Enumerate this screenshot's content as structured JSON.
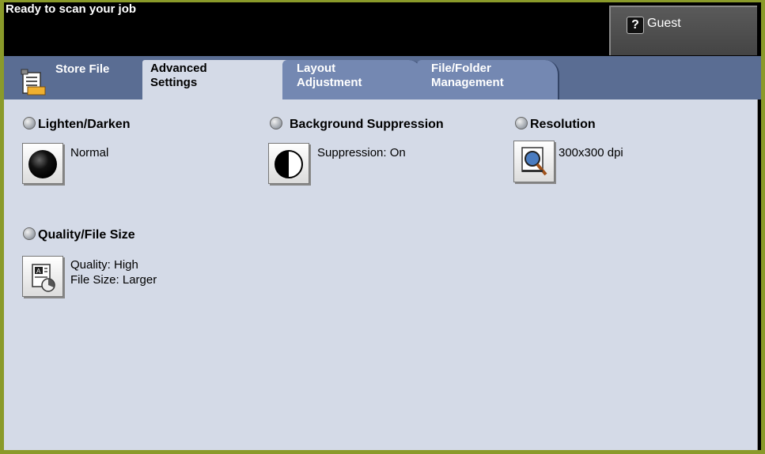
{
  "status": {
    "message": "Ready to scan your job"
  },
  "user": {
    "label": "Guest",
    "help_glyph": "?"
  },
  "tabs": [
    {
      "label_line1": "Store File",
      "label_line2": ""
    },
    {
      "label_line1": "Advanced",
      "label_line2": "Settings"
    },
    {
      "label_line1": "Layout",
      "label_line2": "Adjustment"
    },
    {
      "label_line1": "File/Folder",
      "label_line2": "Management"
    }
  ],
  "settings": {
    "lighten_darken": {
      "title": "Lighten/Darken",
      "value": "Normal"
    },
    "background_suppression": {
      "title": "Background Suppression",
      "value": "Suppression: On"
    },
    "resolution": {
      "title": "Resolution",
      "value": "300x300 dpi"
    },
    "quality_file_size": {
      "title": "Quality/File Size",
      "value_line1": "Quality: High",
      "value_line2": "File Size: Larger"
    }
  },
  "colors": {
    "frame": "#8a9a2a",
    "tab_bar": "#5a6d93",
    "panel": "#d4dae7",
    "inactive_tab": "#7488b2"
  }
}
